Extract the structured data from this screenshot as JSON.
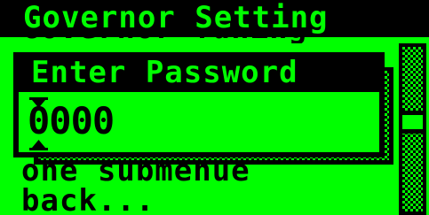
{
  "header": {
    "title": "Governor Setting"
  },
  "menu": {
    "partial_item": "Governor Tuning",
    "sub_item": "one submenue",
    "back_label": "back..."
  },
  "dialog": {
    "title": "Enter Password",
    "password_value": "0000"
  },
  "scrollbar": {
    "position_fraction": 0.45
  },
  "colors": {
    "screen": "#00ff00",
    "ink": "#000000"
  }
}
